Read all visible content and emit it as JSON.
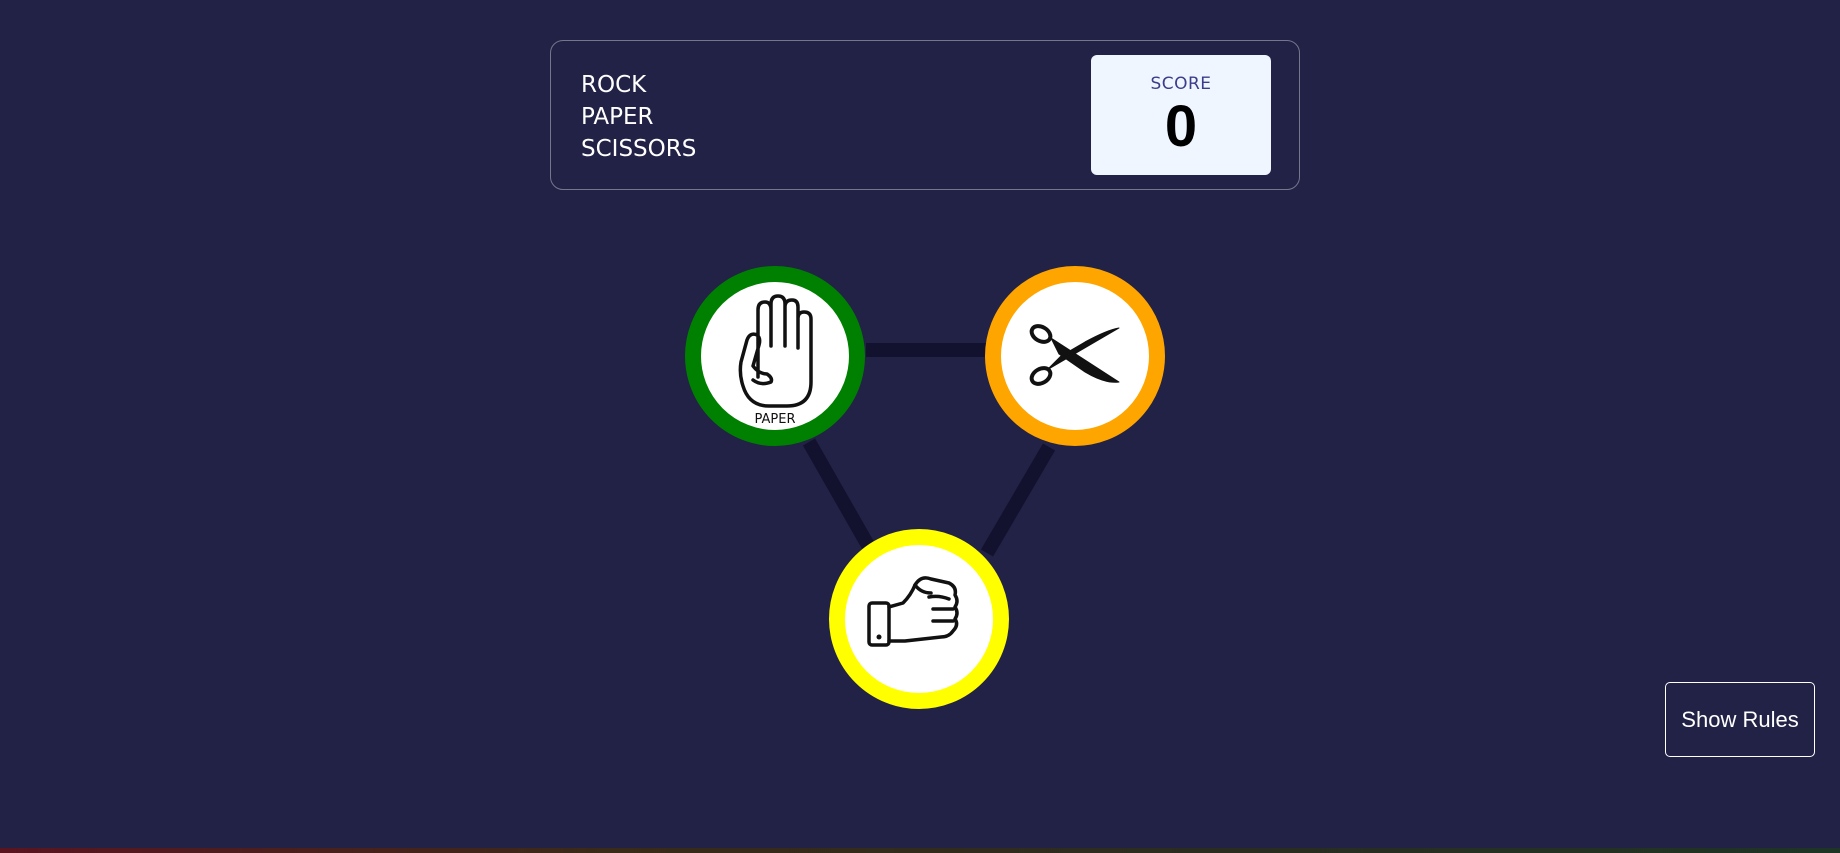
{
  "header": {
    "title_lines": [
      "ROCK",
      "PAPER",
      "SCISSORS"
    ],
    "score_label": "SCORE",
    "score_value": "0"
  },
  "choices": [
    {
      "id": "paper",
      "caption": "PAPER",
      "icon": "hand-icon",
      "ring_color": "#008000"
    },
    {
      "id": "scissors",
      "caption": "",
      "icon": "scissors-icon",
      "ring_color": "#ffa500"
    },
    {
      "id": "rock",
      "caption": "",
      "icon": "fist-icon",
      "ring_color": "#ffff00"
    }
  ],
  "connector_color": "#12122e",
  "rules_button": {
    "label": "Show Rules"
  }
}
